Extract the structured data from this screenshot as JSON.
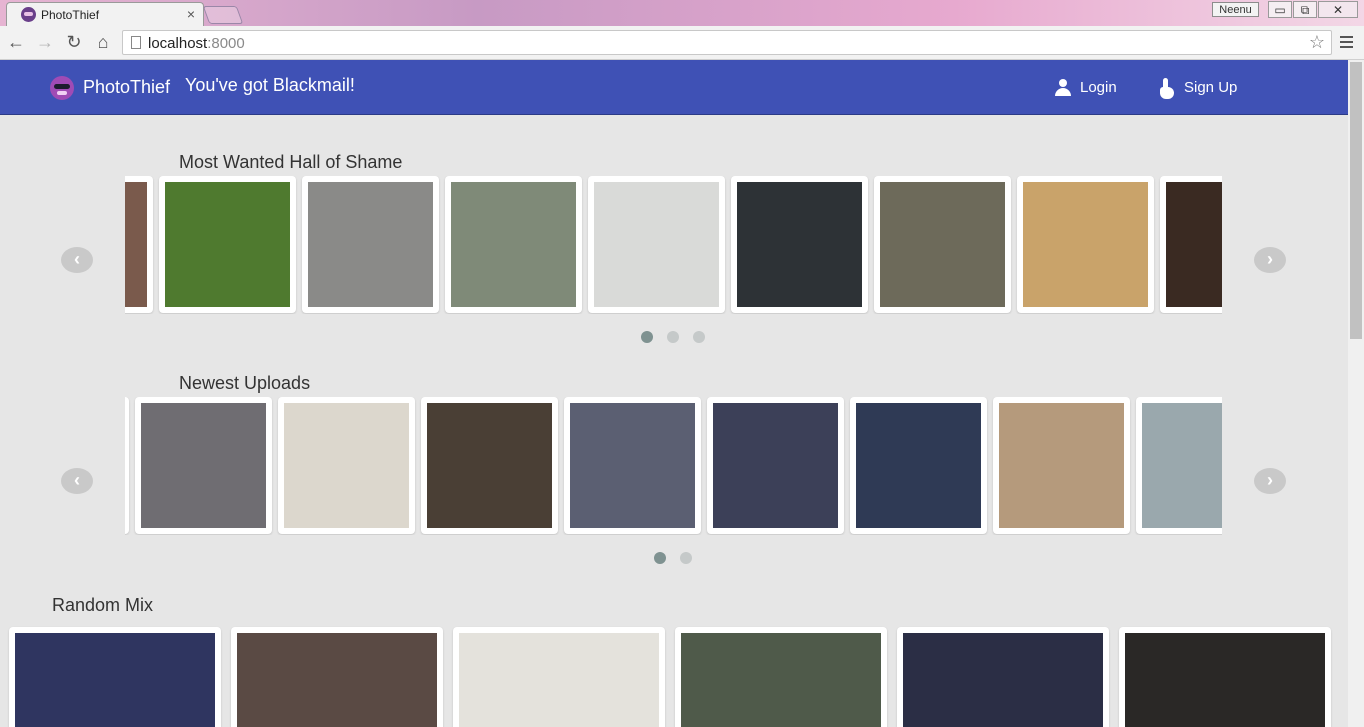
{
  "browser": {
    "tab_title": "PhotoThief",
    "tab_close": "×",
    "user_badge": "Neenu",
    "window_buttons": {
      "minimize": "▭",
      "restore": "⧉",
      "close": "✕"
    },
    "nav": {
      "back": "←",
      "forward": "→",
      "reload": "↻",
      "home": "⌂"
    },
    "url_host": "localhost",
    "url_port": ":8000",
    "bookmark_star": "☆"
  },
  "navbar": {
    "brand": "PhotoThief",
    "tagline": "You've got Blackmail!",
    "login": "Login",
    "signup": "Sign Up"
  },
  "sections": {
    "most_wanted": {
      "title": "Most Wanted Hall of Shame",
      "photo_colors": [
        "#7a5a4c",
        "#4f7a2f",
        "#8a8a88",
        "#7f8a78",
        "#d9dad8",
        "#2d3236",
        "#6d6a5a",
        "#c9a36a",
        "#3a2a22"
      ],
      "pages": 3,
      "active_page": 0,
      "prev_arrow": "‹",
      "next_arrow": "›"
    },
    "newest": {
      "title": "Newest Uploads",
      "photo_colors": [
        "#fafafa",
        "#6f6d72",
        "#dcd7cd",
        "#4a3f35",
        "#5b5f72",
        "#3c4058",
        "#2f3a55",
        "#b59a7c",
        "#9aa8ad"
      ],
      "pages": 2,
      "active_page": 0,
      "prev_arrow": "‹",
      "next_arrow": "›"
    },
    "random_mix": {
      "title": "Random Mix",
      "photo_colors": [
        "#2f3560",
        "#5a4a44",
        "#e4e2dc",
        "#4f5a4a",
        "#2b2e45",
        "#2a2826"
      ]
    }
  }
}
